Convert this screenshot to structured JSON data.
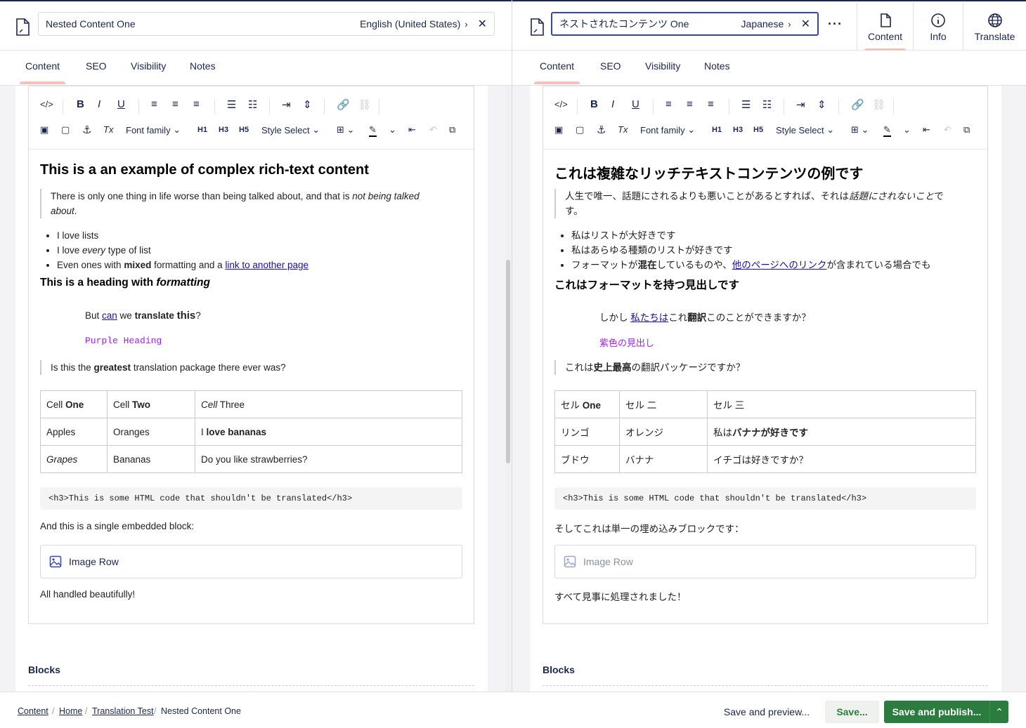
{
  "left": {
    "name": "Nested Content One",
    "language": "English (United States)",
    "tabs": [
      "Content",
      "SEO",
      "Visibility",
      "Notes"
    ],
    "heading": "This is a an example of complex rich-text content",
    "quote": {
      "a": "There is only one thing in life worse than being talked about, and that is ",
      "b": "not being talked about",
      "c": "."
    },
    "list": [
      {
        "a": "I love lists"
      },
      {
        "a": "I love ",
        "b": "every",
        "c": " type of list"
      },
      {
        "a": "Even ones with ",
        "b": "mixed",
        "c": " formatting and a ",
        "link": "link to another page"
      }
    ],
    "heading2": {
      "a": "This is a heading with ",
      "b": "formatting"
    },
    "indent": {
      "a": "But ",
      "link": "can",
      "b": " we ",
      "c": "translate",
      "d": "this",
      "e": "?"
    },
    "purple": "Purple Heading",
    "quote2": {
      "a": "Is this the ",
      "b": "greatest",
      "c": " translation package there ever was?"
    },
    "table": [
      [
        {
          "a": "Cell ",
          "b": "One"
        },
        {
          "a": "Cell ",
          "b": "Two"
        },
        {
          "i": "Cell",
          "a": " Three"
        }
      ],
      [
        {
          "a": "Apples"
        },
        {
          "a": "Oranges"
        },
        {
          "a": "I ",
          "b": "love bananas"
        }
      ],
      [
        {
          "i": "Grapes"
        },
        {
          "a": "Bananas"
        },
        {
          "a": "Do you like strawberries?"
        }
      ]
    ],
    "code": "<h3>This is some HTML code that shouldn't be translated</h3>",
    "para1": "And this is a single embedded block:",
    "block": "Image Row",
    "para2": "All handled beautifully!",
    "blocks_label": "Blocks"
  },
  "right": {
    "name": "ネストされたコンテンツ One",
    "language": "Japanese",
    "tabs": [
      "Content",
      "SEO",
      "Visibility",
      "Notes"
    ],
    "heading": "これは複雑なリッチテキストコンテンツの例です",
    "quote": {
      "a": "人生で唯一、話題にされるよりも悪いことがあるとすれば、それは",
      "b": "話題にされないこと",
      "c": "です。"
    },
    "list": [
      {
        "a": "私はリストが大好きです"
      },
      {
        "a": "私はあらゆる種類のリストが好きです"
      },
      {
        "a": "フォーマットが",
        "b": "混在",
        "c": "しているものや、",
        "link": "他のページへのリンク",
        "d": "が含まれている場合でも"
      }
    ],
    "heading2": {
      "a": "これはフォーマットを持つ見出しです"
    },
    "indent": {
      "a": "しかし ",
      "link": "私たちは",
      "b": "これ",
      "c": "翻訳",
      "e": "このことができますか？"
    },
    "purple": "紫色の見出し",
    "quote2": {
      "a": "これは",
      "b": "史上最高",
      "c": "の翻訳パッケージですか？"
    },
    "table": [
      [
        {
          "a": "セル ",
          "b": "One"
        },
        {
          "a": "セル 二"
        },
        {
          "a": "セル 三"
        }
      ],
      [
        {
          "a": "リンゴ"
        },
        {
          "a": "オレンジ"
        },
        {
          "a": "私は",
          "b": "バナナが好きです"
        }
      ],
      [
        {
          "a": "ブドウ"
        },
        {
          "a": "バナナ"
        },
        {
          "a": "イチゴは好きですか？"
        }
      ]
    ],
    "code": "<h3>This is some HTML code that shouldn't be translated</h3>",
    "para1": "そしてこれは単一の埋め込みブロックです：",
    "block": "Image Row",
    "para2": "すべて見事に処理されました！",
    "blocks_label": "Blocks"
  },
  "toolbar": {
    "font_family": "Font family",
    "style_select": "Style Select",
    "h1": "H1",
    "h3": "H3",
    "h5": "H5"
  },
  "apps": {
    "content": "Content",
    "info": "Info",
    "translate": "Translate"
  },
  "footer": {
    "crumbs": [
      "Content",
      "Home",
      "Translation Test",
      "Nested Content One"
    ],
    "preview": "Save and preview...",
    "save": "Save...",
    "publish": "Save and publish..."
  },
  "colors": {
    "brand": "#1b264f",
    "accent": "#3544b1",
    "publish": "#2b7c3e",
    "purple": "#a020f0",
    "tab_underline": "#f5c1bc"
  }
}
